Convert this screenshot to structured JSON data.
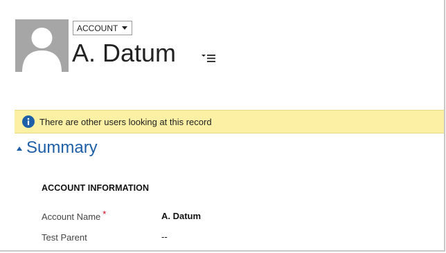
{
  "header": {
    "entity_selector": {
      "label": "ACCOUNT",
      "icon": "chevron-down-icon"
    },
    "record_title": "A. Datum",
    "avatar_icon": "person-icon",
    "menu_icon": "overflow-menu-icon"
  },
  "notification": {
    "icon": "info-icon",
    "text": "There are other users looking at this record",
    "color": "#fbf0a3"
  },
  "section": {
    "title": "Summary",
    "expanded": true,
    "color": "#1f5fa8"
  },
  "account_information": {
    "heading": "ACCOUNT INFORMATION",
    "fields": [
      {
        "label": "Account Name",
        "required": true,
        "required_marker": "*",
        "value": "A. Datum"
      },
      {
        "label": "Test Parent",
        "required": false,
        "value": "--"
      }
    ]
  }
}
